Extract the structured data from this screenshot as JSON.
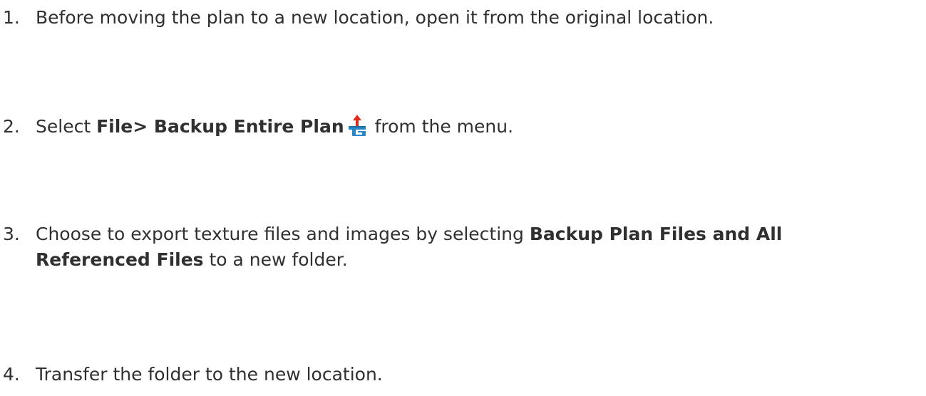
{
  "steps": [
    {
      "number": "1.",
      "text": "Before moving the plan to a new location, open it from the original location."
    },
    {
      "number": "2.",
      "prefix": "Select ",
      "bold": "File> Backup Entire Plan",
      "icon": "backup-entire-plan-icon",
      "suffix": " from the menu."
    },
    {
      "number": "3.",
      "prefix": "Choose to export texture files and images by selecting ",
      "bold_line1": "Backup Plan Files and All",
      "bold_line2": "Referenced Files",
      "suffix": " to a new folder."
    },
    {
      "number": "4.",
      "text": "Transfer the folder to the new location."
    }
  ],
  "colors": {
    "text": "#303030",
    "icon_arrow": "#e02a1c",
    "icon_body": "#2a88c8"
  }
}
